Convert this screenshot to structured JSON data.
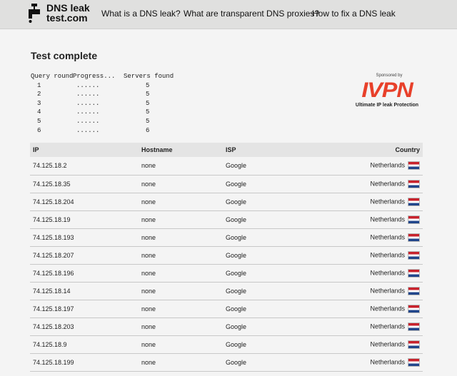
{
  "header": {
    "logo_line1": "DNS leak",
    "logo_line2": "test.com",
    "nav": [
      "What is a DNS leak?",
      "What are transparent DNS proxies?",
      "How to fix a DNS leak"
    ]
  },
  "main": {
    "title": "Test complete",
    "rounds_table": {
      "headers": [
        "Query round",
        "Progress...",
        "Servers found"
      ],
      "rows": [
        {
          "round": "1",
          "progress": "......",
          "servers": "5"
        },
        {
          "round": "2",
          "progress": "......",
          "servers": "5"
        },
        {
          "round": "3",
          "progress": "......",
          "servers": "5"
        },
        {
          "round": "4",
          "progress": "......",
          "servers": "5"
        },
        {
          "round": "5",
          "progress": "......",
          "servers": "5"
        },
        {
          "round": "6",
          "progress": "......",
          "servers": "6"
        }
      ]
    },
    "sponsor": {
      "label": "Sponsored by",
      "brand": "IVPN",
      "tagline": "Ultimate IP leak Protection",
      "brand_color": "#e8402a"
    },
    "results": {
      "headers": {
        "ip": "IP",
        "hostname": "Hostname",
        "isp": "ISP",
        "country": "Country"
      },
      "rows": [
        {
          "ip": "74.125.18.2",
          "hostname": "none",
          "isp": "Google",
          "country": "Netherlands"
        },
        {
          "ip": "74.125.18.35",
          "hostname": "none",
          "isp": "Google",
          "country": "Netherlands"
        },
        {
          "ip": "74.125.18.204",
          "hostname": "none",
          "isp": "Google",
          "country": "Netherlands"
        },
        {
          "ip": "74.125.18.19",
          "hostname": "none",
          "isp": "Google",
          "country": "Netherlands"
        },
        {
          "ip": "74.125.18.193",
          "hostname": "none",
          "isp": "Google",
          "country": "Netherlands"
        },
        {
          "ip": "74.125.18.207",
          "hostname": "none",
          "isp": "Google",
          "country": "Netherlands"
        },
        {
          "ip": "74.125.18.196",
          "hostname": "none",
          "isp": "Google",
          "country": "Netherlands"
        },
        {
          "ip": "74.125.18.14",
          "hostname": "none",
          "isp": "Google",
          "country": "Netherlands"
        },
        {
          "ip": "74.125.18.197",
          "hostname": "none",
          "isp": "Google",
          "country": "Netherlands"
        },
        {
          "ip": "74.125.18.203",
          "hostname": "none",
          "isp": "Google",
          "country": "Netherlands"
        },
        {
          "ip": "74.125.18.9",
          "hostname": "none",
          "isp": "Google",
          "country": "Netherlands"
        },
        {
          "ip": "74.125.18.199",
          "hostname": "none",
          "isp": "Google",
          "country": "Netherlands"
        }
      ],
      "flag_icon": "netherlands-flag-icon"
    }
  }
}
